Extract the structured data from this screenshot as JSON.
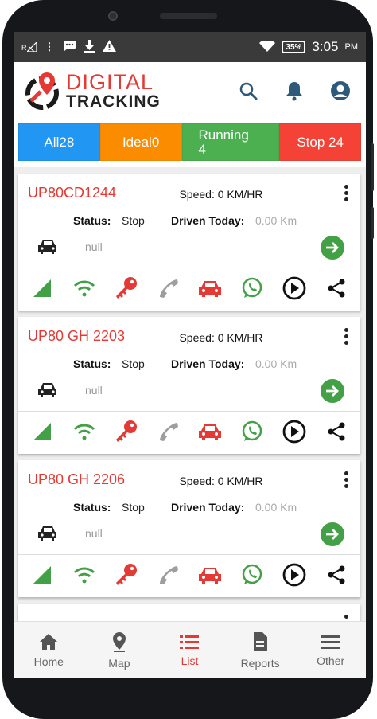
{
  "statusbar": {
    "time": "3:05",
    "ampm": "PM",
    "battery": "35%",
    "left_badge": "R"
  },
  "app": {
    "logo_line1": "DIGITAL",
    "logo_line2": "TRACKING"
  },
  "tabs": [
    {
      "label": "All28",
      "color": "#2196f3"
    },
    {
      "label": "Ideal0",
      "color": "#fb8c00"
    },
    {
      "label_a": "Running",
      "label_b": "4",
      "color": "#4caf50"
    },
    {
      "label": "Stop 24",
      "color": "#f44336"
    }
  ],
  "vehicles": [
    {
      "number": "UP80CD1244",
      "speed": "Speed: 0 KM/HR",
      "status_label": "Status:",
      "status": "Stop",
      "driven_label": "Driven Today:",
      "driven": "0.00 Km",
      "address": "null"
    },
    {
      "number": "UP80 GH 2203",
      "speed": "Speed: 0 KM/HR",
      "status_label": "Status:",
      "status": "Stop",
      "driven_label": "Driven Today:",
      "driven": "0.00 Km",
      "address": "null"
    },
    {
      "number": "UP80 GH 2206",
      "speed": "Speed: 0 KM/HR",
      "status_label": "Status:",
      "status": "Stop",
      "driven_label": "Driven Today:",
      "driven": "0.00 Km",
      "address": "null"
    }
  ],
  "card_icons": [
    "signal-icon",
    "wifi-icon",
    "key-icon",
    "phone-icon",
    "car-icon",
    "whatsapp-icon",
    "play-icon",
    "share-icon"
  ],
  "colors": {
    "accent": "#e53935",
    "green": "#43a047",
    "grey_phone": "#9e9e9e"
  },
  "bottomnav": [
    {
      "label": "Home",
      "icon": "home-icon"
    },
    {
      "label": "Map",
      "icon": "map-pin-icon"
    },
    {
      "label": "List",
      "icon": "list-icon",
      "active": true
    },
    {
      "label": "Reports",
      "icon": "report-icon"
    },
    {
      "label": "Other",
      "icon": "menu-icon"
    }
  ]
}
